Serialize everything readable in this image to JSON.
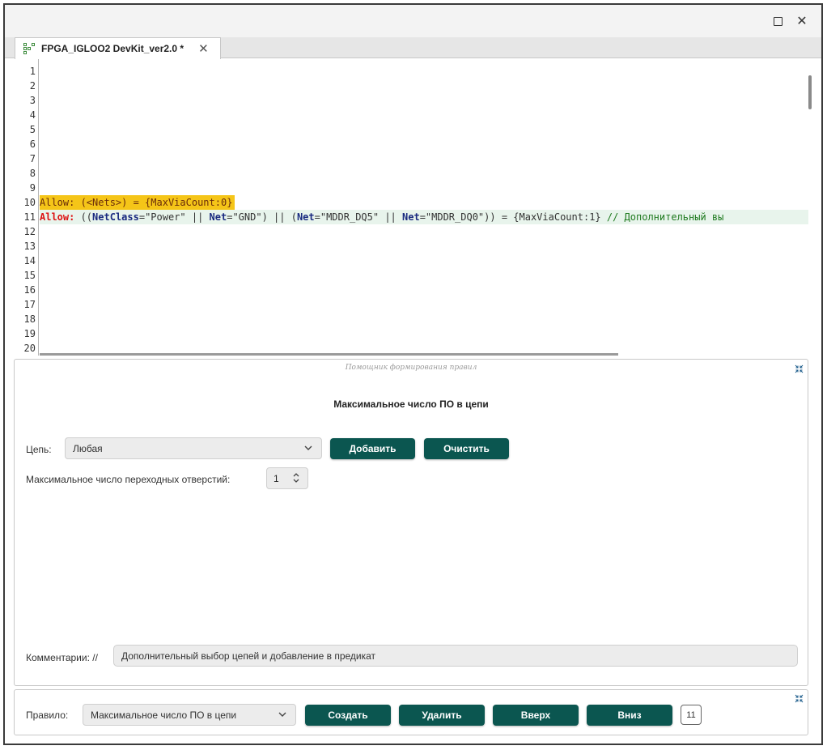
{
  "window": {
    "maximize_icon": "maximize-icon",
    "close_glyph": "✕"
  },
  "tab": {
    "icon": "grid-icon",
    "label": "FPGA_IGLOO2 DevKit_ver2.0 *",
    "close_glyph": "✕"
  },
  "editor": {
    "line_numbers": [
      "1",
      "2",
      "3",
      "4",
      "5",
      "6",
      "7",
      "8",
      "9",
      "10",
      "11",
      "12",
      "13",
      "14",
      "15",
      "16",
      "17",
      "18",
      "19",
      "20"
    ],
    "line10": {
      "text": "Allow: (<Nets>) = {MaxViaCount:0}",
      "highlight_color": "#f5c518"
    },
    "line11": {
      "kw_allow": "Allow:",
      "p1": " ((",
      "kw_netclass": "NetClass",
      "p2": "=\"Power\" || ",
      "kw_net1": "Net",
      "p3": "=\"GND\") || (",
      "kw_net2": "Net",
      "p4": "=\"MDDR_DQ5\" || ",
      "kw_net3": "Net",
      "p5": "=\"MDDR_DQ0\")) = {MaxViaCount:1} ",
      "comment": "// Дополнительный вы",
      "highlight_color": "#e8f4ec"
    }
  },
  "helper": {
    "caption": "Помощник формирования правил",
    "collapse_icon": "collapse-icon",
    "title": "Максимальное число ПО в цепи",
    "net_label": "Цепь:",
    "net_value": "Любая",
    "add_button": "Добавить",
    "clear_button": "Очистить",
    "via_label": "Максимальное число переходных отверстий:",
    "via_value": "1",
    "comment_label": "Комментарии: //",
    "comment_value": "Дополнительный выбор цепей и добавление в предикат"
  },
  "rulebar": {
    "collapse_icon": "collapse-icon",
    "rule_label": "Правило:",
    "rule_value": "Максимальное число ПО в цепи",
    "create_button": "Создать",
    "delete_button": "Удалить",
    "up_button": "Вверх",
    "down_button": "Вниз",
    "count": "11"
  },
  "colors": {
    "button_bg": "#0b5650",
    "keyword_red": "#d11111",
    "keyword_blue": "#1a2a80",
    "comment_green": "#1f7a1f"
  }
}
